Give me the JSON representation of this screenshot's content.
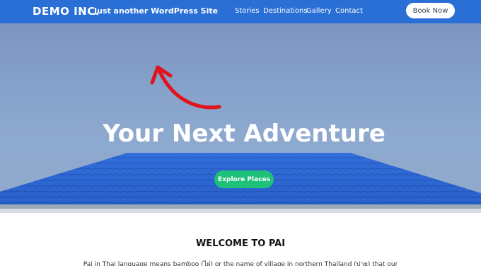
{
  "site": {
    "brand": "DEMO INC.",
    "tagline": "Just another WordPress Site"
  },
  "nav": {
    "items": [
      "Stories",
      "Destinations",
      "Gallery",
      "Contact"
    ],
    "book_label": "Book Now"
  },
  "hero": {
    "title": "Your Next Adventure",
    "cta_label": "Explore Places"
  },
  "content": {
    "heading": "WELCOME TO PAI",
    "intro": "Pai in Thai language means bamboo (ไผ่) or the name of village in northern Thailand (ปาย) that our"
  },
  "colors": {
    "header": "#2a6fd6",
    "cta": "#1fc07a",
    "roof": "#2b67d6",
    "annotation_arrow": "#e0141c"
  }
}
